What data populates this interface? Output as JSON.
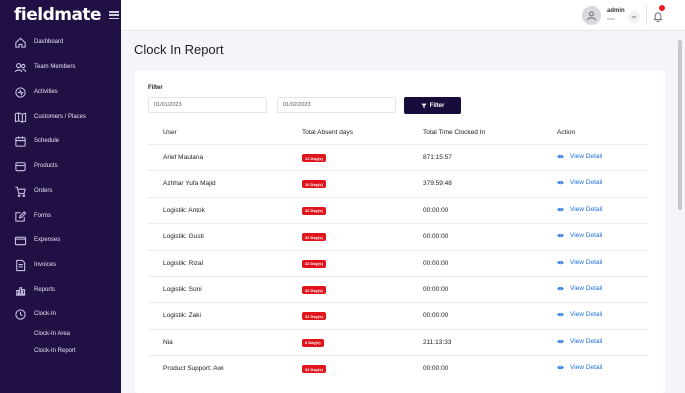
{
  "app": {
    "logo": "fieldmate"
  },
  "sidebar": {
    "items": [
      {
        "label": "Dashboard",
        "icon": "home-icon"
      },
      {
        "label": "Team Members",
        "icon": "team-icon"
      },
      {
        "label": "Activities",
        "icon": "activity-icon"
      },
      {
        "label": "Customers / Places",
        "icon": "map-icon"
      },
      {
        "label": "Schedule",
        "icon": "calendar-icon"
      },
      {
        "label": "Products",
        "icon": "product-icon"
      },
      {
        "label": "Orders",
        "icon": "cart-icon"
      },
      {
        "label": "Forms",
        "icon": "form-icon"
      },
      {
        "label": "Expenses",
        "icon": "wallet-icon"
      },
      {
        "label": "Invoices",
        "icon": "invoice-icon"
      },
      {
        "label": "Reports",
        "icon": "report-icon"
      },
      {
        "label": "Clock-In",
        "icon": "clock-icon"
      }
    ],
    "subitems": [
      {
        "label": "Clock-In Area"
      },
      {
        "label": "Clock-In Report"
      }
    ]
  },
  "topbar": {
    "user_name": "admin",
    "user_role": "xxxx"
  },
  "page": {
    "title": "Clock In Report"
  },
  "filter": {
    "label": "Filter",
    "start_date": "01/01/2023",
    "end_date": "01/02/2023",
    "button_label": "Filter"
  },
  "table": {
    "headers": [
      "User",
      "Total Absent days",
      "Total Time Clocked In",
      "Action"
    ],
    "rows": [
      {
        "user": "Arief Maulana",
        "absent": "12 Day(s)",
        "time": "871:15:57",
        "action": "View Detail"
      },
      {
        "user": "Azhhar Yufa Majid",
        "absent": "10 Day(s)",
        "time": "379:59:48",
        "action": "View Detail"
      },
      {
        "user": "Logistik: Antok",
        "absent": "32 Day(s)",
        "time": "00:00:00",
        "action": "View Detail"
      },
      {
        "user": "Logistik: Gusti",
        "absent": "32 Day(s)",
        "time": "00:00:00",
        "action": "View Detail"
      },
      {
        "user": "Logistik: Rizal",
        "absent": "32 Day(s)",
        "time": "00:00:00",
        "action": "View Detail"
      },
      {
        "user": "Logistik: Soni",
        "absent": "32 Day(s)",
        "time": "00:00:00",
        "action": "View Detail"
      },
      {
        "user": "Logistik: Zaki",
        "absent": "32 Day(s)",
        "time": "00:00:00",
        "action": "View Detail"
      },
      {
        "user": "Nia",
        "absent": "8 Day(s)",
        "time": "211:13:33",
        "action": "View Detail"
      },
      {
        "user": "Product Support: Awi",
        "absent": "32 Day(s)",
        "time": "00:00:00",
        "action": "View Detail"
      }
    ]
  },
  "colors": {
    "sidebar": "#201044",
    "accent": "#180c3c",
    "badge": "#e0141b",
    "link": "#1b6fe0"
  }
}
